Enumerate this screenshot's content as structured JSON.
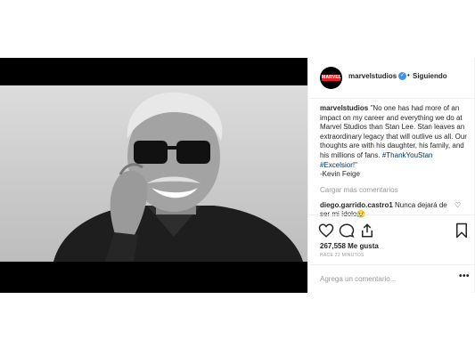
{
  "post": {
    "username": "marvelstudios",
    "avatar_logo_text": "MARVEL STUDIOS",
    "follow_status": "Siguiendo",
    "separator": "•",
    "caption": {
      "username": "marvelstudios",
      "text": "\"No one has had more of an impact on my career and everything we do at Marvel Studios than Stan Lee. Stan leaves an extraordinary legacy that will outlive us all. Our thoughts are with his daughter, his family, and his millions of fans.",
      "hashtag1": "#ThankYouStan",
      "hashtag2": "#Excelsior!",
      "closing_quote": "\"",
      "signature": "-Kevin Feige"
    },
    "load_more": "Cargar más comentarios",
    "comment": {
      "username": "diego.garrido.castro1",
      "text": "Nunca dejará de ser mi ídolo😥"
    },
    "likes": "267,558 Me gusta",
    "time_ago": "HACE 22 MINUTOS",
    "add_comment_placeholder": "Agrega un comentario...",
    "more_options": "•••"
  },
  "icons": {
    "like": "heart-icon",
    "comment": "comment-bubble-icon",
    "share": "share-icon",
    "save": "bookmark-icon",
    "verified": "verified-badge-icon"
  },
  "colors": {
    "verified": "#3897f0",
    "hashtag": "#003569",
    "muted": "#999999",
    "marvel_red": "#ec1d24"
  }
}
